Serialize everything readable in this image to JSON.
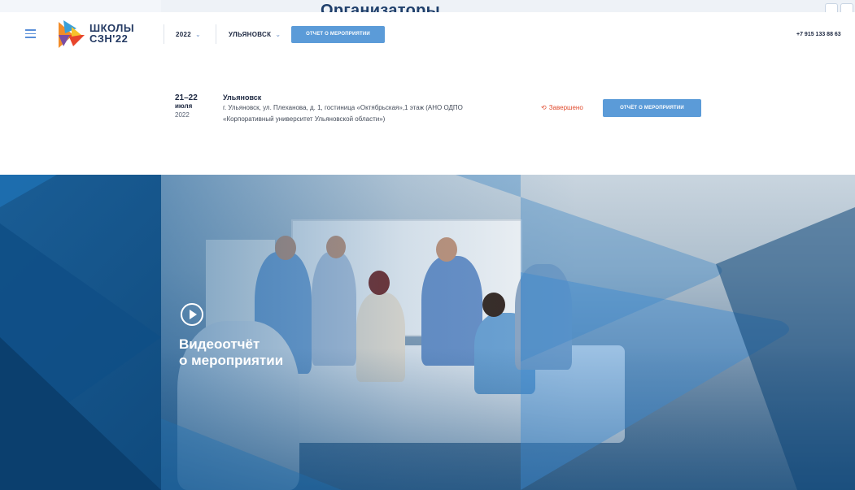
{
  "header": {
    "logo_line1": "ШКОЛЫ",
    "logo_line2": "СЗН'22",
    "year_dropdown": "2022",
    "city_dropdown": "УЛЬЯНОВСК",
    "report_button": "ОТЧЕТ О МЕРОПРИЯТИИ",
    "phone": "+7 915 133 88 63"
  },
  "background_section": {
    "title": "Организаторы"
  },
  "event": {
    "day": "21–22",
    "month": "июля",
    "year": "2022",
    "city": "Ульяновск",
    "address_line1": "г. Ульяновск, ул. Плеханова, д. 1, гостиница «Октябрьская»,1 этаж (АНО ОДПО",
    "address_line2": "«Корпоративный университет Ульяновской области»)",
    "status": "Завершено",
    "report_button": "ОТЧЁТ О МЕРОПРИЯТИИ"
  },
  "hero": {
    "video_line1": "Видеоотчёт",
    "video_line2": "о мероприятии"
  },
  "colors": {
    "accent": "#5b9bd8",
    "status": "#e04b2e",
    "hero_dark": "#0d4678",
    "text_dark": "#1c2740"
  }
}
